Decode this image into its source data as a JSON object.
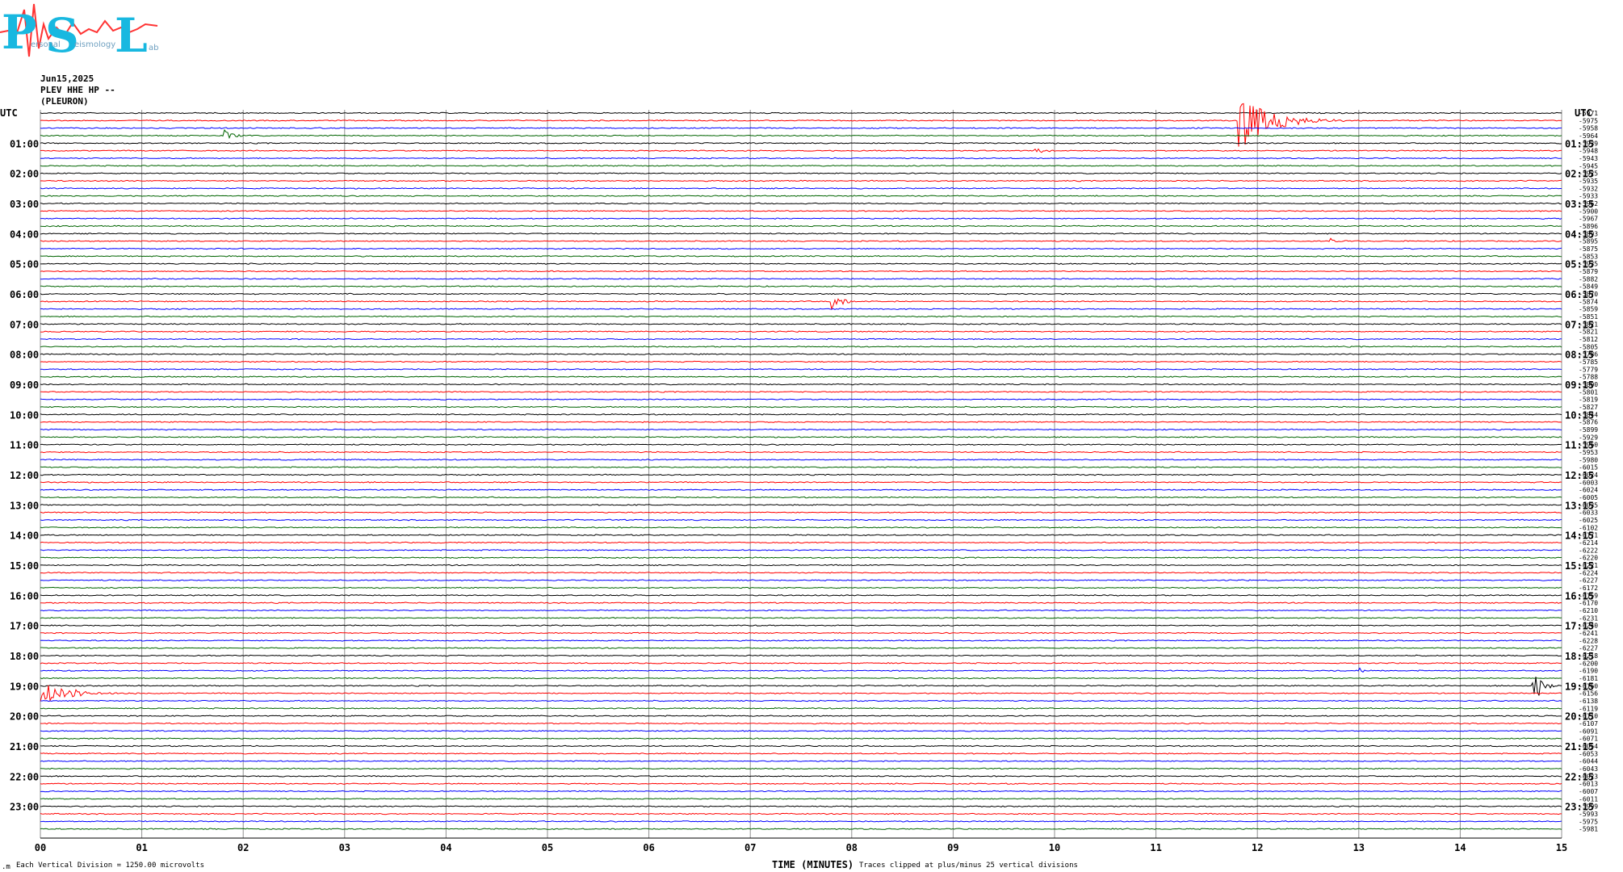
{
  "logo": {
    "letters": [
      "P",
      "S",
      "L"
    ],
    "small_text": [
      "ersonal",
      "eismology",
      "ab"
    ]
  },
  "header": {
    "date": "Jun15,2025",
    "station": "PLEV HHE HP --",
    "location": "(PLEURON)"
  },
  "chart_data": {
    "type": "line",
    "title": "",
    "xlabel": "TIME (MINUTES)",
    "ylabel": "",
    "xlim": [
      0,
      15
    ],
    "x_ticks": [
      "00",
      "01",
      "02",
      "03",
      "04",
      "05",
      "06",
      "07",
      "08",
      "09",
      "10",
      "11",
      "12",
      "13",
      "14",
      "15"
    ],
    "left_axis_label": "UTC",
    "right_axis_label": "UTC",
    "left_hour_labels": [
      "01:00",
      "02:00",
      "03:00",
      "04:00",
      "05:00",
      "06:00",
      "07:00",
      "08:00",
      "09:00",
      "10:00",
      "11:00",
      "12:00",
      "13:00",
      "14:00",
      "15:00",
      "16:00",
      "17:00",
      "18:00",
      "19:00",
      "20:00",
      "21:00",
      "22:00",
      "23:00"
    ],
    "right_hour_labels": [
      "01:15",
      "02:15",
      "03:15",
      "04:15",
      "05:15",
      "06:15",
      "07:15",
      "08:15",
      "09:15",
      "10:15",
      "11:15",
      "12:15",
      "13:15",
      "14:15",
      "15:15",
      "16:15",
      "17:15",
      "18:15",
      "19:15",
      "20:15",
      "21:15",
      "22:15",
      "23:15"
    ],
    "trace_colors": [
      "#000000",
      "#ff0000",
      "#0000ff",
      "#006400"
    ],
    "trace_count": 96,
    "trace_offsets": [
      "-5971",
      "-5975",
      "-5958",
      "-5964",
      "-5939",
      "-5948",
      "-5943",
      "-5945",
      "-5925",
      "-5935",
      "-5932",
      "-5933",
      "-5962",
      "-5900",
      "-5967",
      "-5896",
      "-5893",
      "-5895",
      "-5875",
      "-5853",
      "-5935",
      "-5879",
      "-5882",
      "-5849",
      "-5870",
      "-5874",
      "-5859",
      "-5851",
      "-5821",
      "-5821",
      "-5812",
      "-5805",
      "-5786",
      "-5785",
      "-5779",
      "-5788",
      "-5800",
      "-5801",
      "-5819",
      "-5827",
      "-5844",
      "-5876",
      "-5899",
      "-5929",
      "-5960",
      "-5953",
      "-5980",
      "-6015",
      "-6024",
      "-6003",
      "-6024",
      "-6005",
      "-6035",
      "-6033",
      "-6025",
      "-6102",
      "-6171",
      "-6214",
      "-6222",
      "-6220",
      "-6221",
      "-6224",
      "-6227",
      "-6172",
      "-6159",
      "-6170",
      "-6210",
      "-6231",
      "-6240",
      "-6241",
      "-6228",
      "-6227",
      "-6218",
      "-6200",
      "-6190",
      "-6181",
      "-6160",
      "-6156",
      "-6138",
      "-6119",
      "-6110",
      "-6107",
      "-6091",
      "-6071",
      "-6054",
      "-6053",
      "-6044",
      "-6043",
      "-6023",
      "-6013",
      "-6007",
      "-6011",
      "-5999",
      "-5993",
      "-5975",
      "-5981"
    ],
    "events": [
      {
        "trace": 1,
        "start_min": 11.8,
        "end_min": 12.9,
        "amplitude": 0.95,
        "color": "#ff0000"
      },
      {
        "trace": 3,
        "start_min": 1.8,
        "end_min": 2.1,
        "amplitude": 0.2,
        "color": "#006400"
      },
      {
        "trace": 5,
        "start_min": 9.8,
        "end_min": 10.05,
        "amplitude": 0.12,
        "color": "#ff0000"
      },
      {
        "trace": 17,
        "start_min": 12.7,
        "end_min": 12.9,
        "amplitude": 0.12,
        "color": "#ff0000"
      },
      {
        "trace": 25,
        "start_min": 7.8,
        "end_min": 8.2,
        "amplitude": 0.25,
        "color": "#ff0000"
      },
      {
        "trace": 74,
        "start_min": 13.0,
        "end_min": 13.2,
        "amplitude": 0.12,
        "color": "#0000ff"
      },
      {
        "trace": 76,
        "start_min": 14.7,
        "end_min": 15.0,
        "amplitude": 0.8,
        "color": "#000000"
      },
      {
        "trace": 77,
        "start_min": 0.0,
        "end_min": 1.0,
        "amplitude": 0.35,
        "color": "#ff0000"
      }
    ]
  },
  "footer": {
    "left_note": "Each Vertical Division = 1250.00 microvolts",
    "right_note": "Traces clipped at plus/minus 25 vertical divisions",
    "corner_mark": ".m"
  }
}
